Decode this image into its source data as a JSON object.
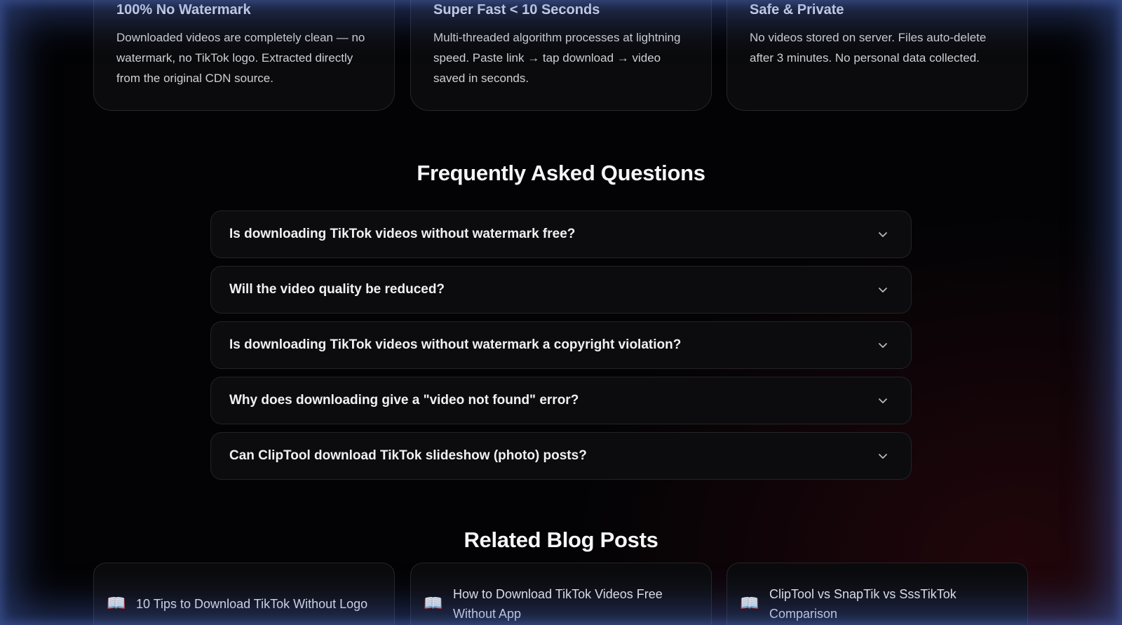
{
  "features": [
    {
      "title": "100% No Watermark",
      "description": "Downloaded videos are completely clean — no watermark, no TikTok logo. Extracted directly from the original CDN source."
    },
    {
      "title": "Super Fast < 10 Seconds",
      "description": "Multi-threaded algorithm processes at lightning speed. Paste link → tap download → video saved in seconds."
    },
    {
      "title": "Safe & Private",
      "description": "No videos stored on server. Files auto-delete after 3 minutes. No personal data collected."
    }
  ],
  "faq": {
    "heading": "Frequently Asked Questions",
    "items": [
      {
        "question": "Is downloading TikTok videos without watermark free?"
      },
      {
        "question": "Will the video quality be reduced?"
      },
      {
        "question": "Is downloading TikTok videos without watermark a copyright violation?"
      },
      {
        "question": "Why does downloading give a \"video not found\" error?"
      },
      {
        "question": "Can ClipTool download TikTok slideshow (photo) posts?"
      }
    ],
    "toggle_icon": "chevron-down-icon"
  },
  "blog": {
    "heading": "Related Blog Posts",
    "icon": "📖",
    "posts": [
      {
        "title": "10 Tips to Download TikTok Without Logo"
      },
      {
        "title": "How to Download TikTok Videos Free Without App"
      },
      {
        "title": "ClipTool vs SnapTik vs SssTikTok Comparison"
      }
    ]
  },
  "colors": {
    "background": "#030305",
    "card": "#0b0b0d",
    "border": "#26262b",
    "edge_glow": "#4664be"
  }
}
